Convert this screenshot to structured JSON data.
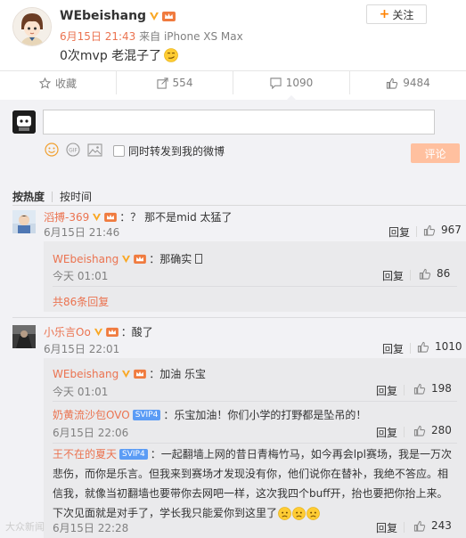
{
  "post": {
    "username": "WEbeishang",
    "follow_label": "关注",
    "date": "6月15日 21:43",
    "source": " 来自 iPhone XS Max",
    "text": "0次mvp 老混子了"
  },
  "actions": [
    {
      "label": "收藏",
      "icon": "star-icon"
    },
    {
      "label": "554",
      "icon": "forward-icon"
    },
    {
      "label": "1090",
      "icon": "comment-icon"
    },
    {
      "label": "9484",
      "icon": "like-icon"
    }
  ],
  "composer": {
    "placeholder": "",
    "also_forward_label": "同时转发到我的微博",
    "submit_label": "评论"
  },
  "sort": {
    "hot": "按热度",
    "time": "按时间"
  },
  "reply_label": "回复",
  "comments": [
    {
      "user": "滔搏-369",
      "text": "：？ 那不是mid 太猛了",
      "time": "6月15日 21:46",
      "likes": "967",
      "replies": [
        {
          "user": "WEbeishang",
          "text": "：那确实",
          "time": "今天 01:01",
          "likes": "86"
        }
      ],
      "more": "共86条回复"
    },
    {
      "user": "小乐言Oo",
      "text": "：酸了",
      "time": "6月15日 22:01",
      "likes": "1010",
      "replies": [
        {
          "user": "WEbeishang",
          "text": "：加油 乐宝",
          "time": "今天 01:01",
          "likes": "198"
        },
        {
          "user": "奶黄流沙包OVO",
          "badge": "SVIP4",
          "text": "：乐宝加油！你们小学的打野都是坠吊的！",
          "time": "6月15日 22:06",
          "likes": "280"
        },
        {
          "user": "王不在的夏天",
          "badge": "SVIP4",
          "text_lines": [
            "：一起翻墙上网的昔日青梅竹马，如今再会lpl赛场，我是一万次",
            "悲伤，而你是乐言。但我来到赛场才发现没有你，他们说你在替补，我绝不答应。相",
            "信我，就像当初翻墙也要带你去网吧一样，这次我四个buff开，抬也要把你抬上来。",
            "下次见面就是对手了，学长我只能爱你到这里了"
          ],
          "time": "6月15日 22:28",
          "likes": "243"
        }
      ]
    }
  ],
  "watermark": "大众新闻",
  "colors": {
    "accent": "#eb7350",
    "follow_plus": "#ff8200",
    "submit_bg": "#ffc09f",
    "panel_bg": "#f2f2f5",
    "sub_bg": "#eaeaec",
    "vip_gold": "#f9a825"
  }
}
